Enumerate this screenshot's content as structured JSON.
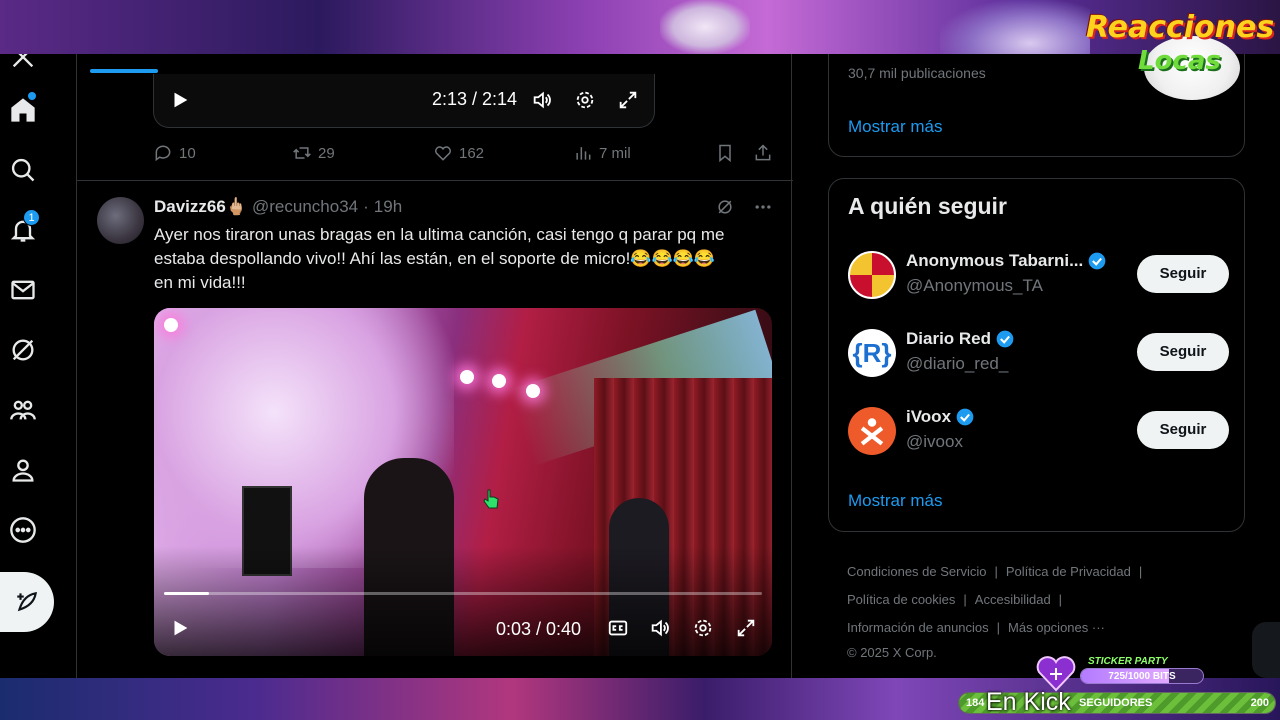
{
  "overlay": {
    "logo_line1": "Reacciones",
    "logo_line2": "Locas",
    "sticker_label": "STICKER PARTY",
    "sticker_progress": "725/1000 BITS",
    "sticker_fraction": 0.725,
    "followers_min": "184",
    "followers_label": "SEGUIDORES",
    "followers_max": "200",
    "kick_text": "En Kick"
  },
  "nav": {
    "icons": [
      "x-logo-icon",
      "home-icon",
      "search-icon",
      "bell-icon",
      "mail-icon",
      "grok-icon",
      "communities-icon",
      "profile-icon",
      "more-icon",
      "compose-icon"
    ],
    "notifications_badge": "1"
  },
  "prev_post": {
    "video_time": "2:13 / 2:14",
    "replies": "10",
    "reposts": "29",
    "likes": "162",
    "views": "7 mil"
  },
  "post": {
    "author": "Davizz66🖕🏼",
    "handle": "@recuncho34",
    "separator": "·",
    "time": "19h",
    "text_line1": "Ayer nos tiraron unas bragas en la ultima canción, casi tengo q parar pq me",
    "text_line2": "estaba despollando vivo!! Ahí las están, en el soporte de micro!😂😂😂😂",
    "text_line3": "en mi vida!!!",
    "video_time": "0:03 / 0:40",
    "video_progress_fraction": 0.075
  },
  "sidebar": {
    "top_card_faded": "30,7 mil publicaciones",
    "show_more": "Mostrar más",
    "who_to_follow_title": "A quién seguir",
    "suggestions": [
      {
        "name": "Anonymous Tabarni...",
        "handle": "@Anonymous_TA",
        "button": "Seguir"
      },
      {
        "name": "Diario Red",
        "handle": "@diario_red_",
        "button": "Seguir"
      },
      {
        "name": "iVoox",
        "handle": "@ivoox",
        "button": "Seguir"
      }
    ],
    "show_more_2": "Mostrar más",
    "footer": {
      "terms": "Condiciones de Servicio",
      "privacy": "Política de Privacidad",
      "cookies": "Política de cookies",
      "accessibility": "Accesibilidad",
      "ads": "Información de anuncios",
      "more": "Más opciones ···",
      "copyright": "© 2025 X Corp."
    }
  },
  "colors": {
    "accent": "#1d9bf0",
    "background": "#000000",
    "text": "#e7e9ea",
    "muted": "#71767b"
  }
}
